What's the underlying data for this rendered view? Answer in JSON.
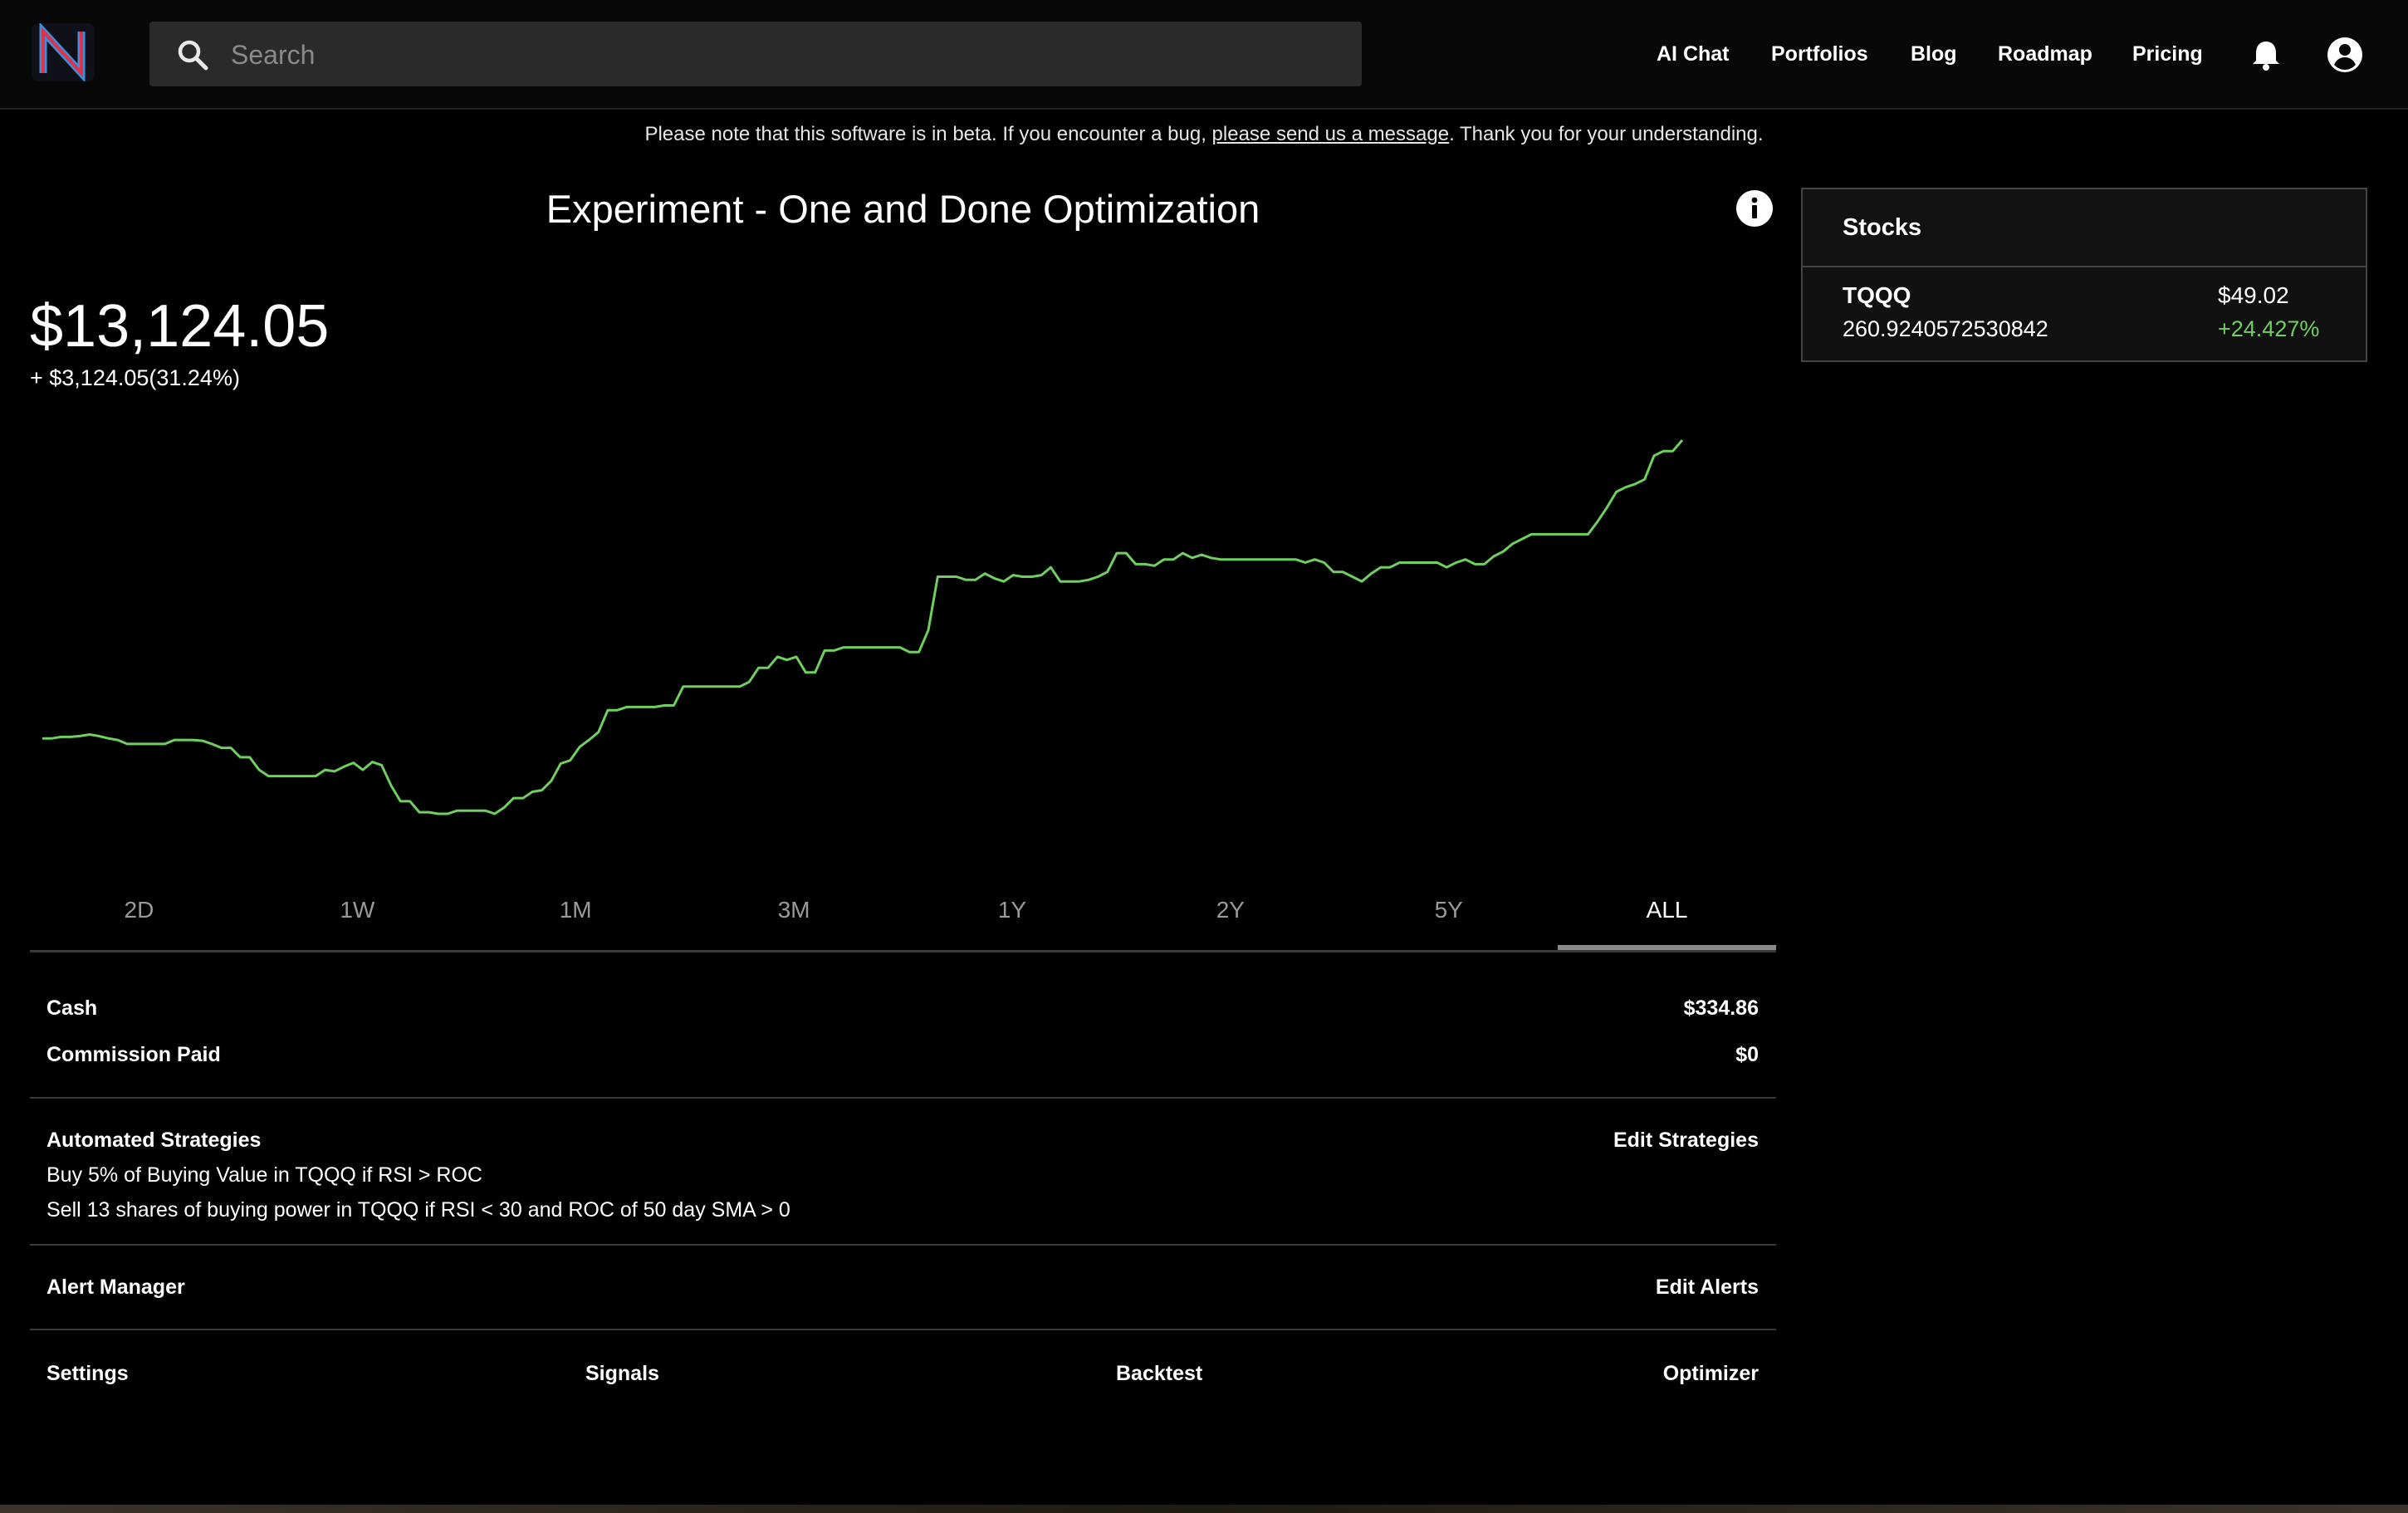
{
  "nav": {
    "search_placeholder": "Search",
    "links": [
      "AI Chat",
      "Portfolios",
      "Blog",
      "Roadmap",
      "Pricing"
    ],
    "icons": {
      "logo": "logo-n-icon",
      "search": "search-icon",
      "bell": "bell-icon",
      "account": "account-circle-icon"
    }
  },
  "banner": {
    "before": "Please note that this software is in beta. If you encounter a bug, ",
    "link": "please send us a message",
    "after": ". Thank you for your understanding."
  },
  "portfolio": {
    "title": "Experiment - One and Done Optimization",
    "value": "$13,124.05",
    "change": "+ $3,124.05(31.24%)",
    "line_color": "#6fcf5f"
  },
  "chart_data": {
    "type": "line",
    "series": [
      {
        "values": [
          10000,
          10000,
          10010,
          10010,
          10015,
          10025,
          10015,
          10000,
          9990,
          9965,
          9965,
          9965,
          9965,
          9965,
          9990,
          9990,
          9990,
          9985,
          9965,
          9940,
          9940,
          9880,
          9880,
          9800,
          9760,
          9760,
          9760,
          9760,
          9760,
          9760,
          9800,
          9790,
          9820,
          9845,
          9800,
          9850,
          9830,
          9700,
          9600,
          9600,
          9530,
          9530,
          9520,
          9520,
          9540,
          9540,
          9540,
          9540,
          9520,
          9560,
          9620,
          9620,
          9660,
          9670,
          9730,
          9840,
          9860,
          9945,
          9990,
          10040,
          10180,
          10180,
          10200,
          10200,
          10200,
          10200,
          10210,
          10210,
          10330,
          10330,
          10330,
          10330,
          10330,
          10330,
          10330,
          10360,
          10450,
          10450,
          10520,
          10500,
          10520,
          10420,
          10420,
          10560,
          10560,
          10580,
          10580,
          10580,
          10580,
          10580,
          10580,
          10580,
          10550,
          10550,
          10690,
          11030,
          11030,
          11030,
          11010,
          11010,
          11050,
          11020,
          11000,
          11040,
          11030,
          11030,
          11040,
          11090,
          11000,
          11000,
          11000,
          11010,
          11030,
          11060,
          11180,
          11180,
          11110,
          11110,
          11100,
          11140,
          11140,
          11180,
          11150,
          11170,
          11150,
          11140,
          11140,
          11140,
          11140,
          11140,
          11140,
          11140,
          11140,
          11140,
          11120,
          11140,
          11120,
          11060,
          11060,
          11030,
          11000,
          11050,
          11090,
          11090,
          11120,
          11120,
          11120,
          11120,
          11120,
          11090,
          11120,
          11140,
          11110,
          11110,
          11160,
          11190,
          11240,
          11270,
          11300,
          11300,
          11300,
          11300,
          11300,
          11300,
          11300,
          11380,
          11470,
          11570,
          11600,
          11620,
          11650,
          11800,
          11830,
          11830,
          11900
        ]
      }
    ],
    "grid": false,
    "axes_visible": false
  },
  "ranges": {
    "items": [
      "2D",
      "1W",
      "1M",
      "3M",
      "1Y",
      "2Y",
      "5Y",
      "ALL"
    ],
    "active": "ALL"
  },
  "details": {
    "cash_label": "Cash",
    "cash_value": "$334.86",
    "commission_label": "Commission Paid",
    "commission_value": "$0",
    "strategies_label": "Automated Strategies",
    "edit_strategies": "Edit Strategies",
    "strategies": [
      "Buy 5% of Buying Value in TQQQ if RSI > ROC",
      "Sell 13 shares of buying power in TQQQ if RSI < 30 and ROC of 50 day SMA > 0"
    ],
    "alert_label": "Alert Manager",
    "edit_alerts": "Edit Alerts",
    "settings": "Settings",
    "signals": "Signals",
    "backtest": "Backtest",
    "optimizer": "Optimizer"
  },
  "stocks": {
    "title": "Stocks",
    "items": [
      {
        "symbol": "TQQQ",
        "quantity": "260.9240572530842",
        "price": "$49.02",
        "change": "+24.427%",
        "change_color": "#6fcf5f"
      }
    ]
  }
}
